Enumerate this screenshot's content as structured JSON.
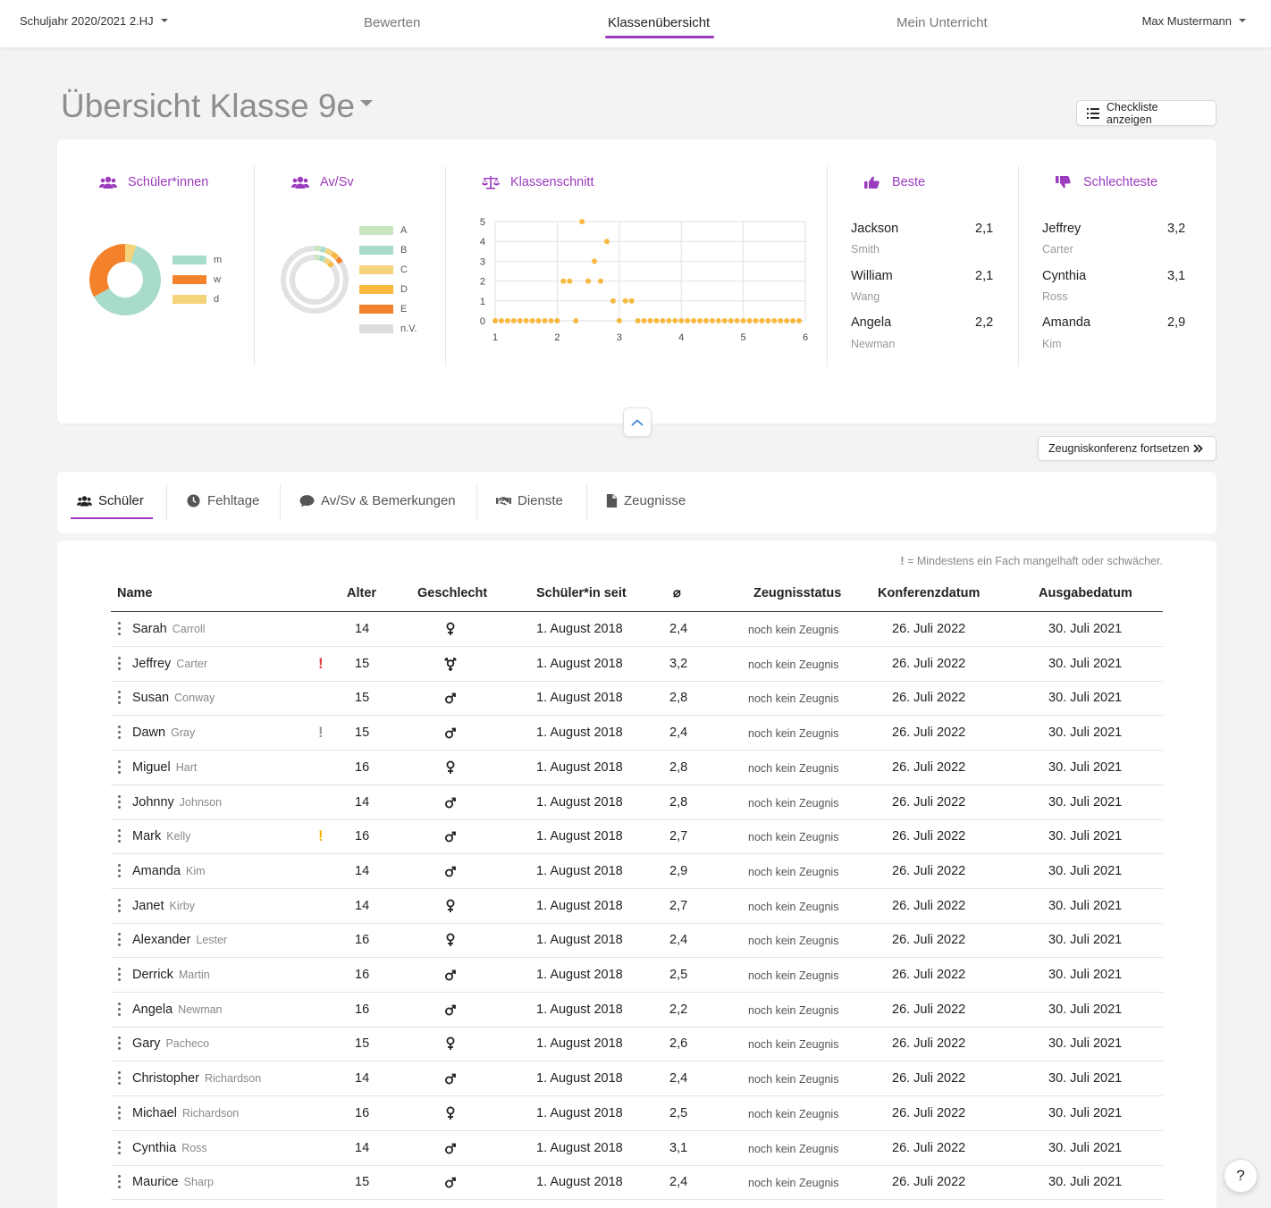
{
  "nav": {
    "year": "Schuljahr 2020/2021 2.HJ",
    "tabs": [
      "Bewerten",
      "Klassenübersicht",
      "Mein Unterricht"
    ],
    "active_tab": "Klassenübersicht",
    "user": "Max Mustermann",
    "accent": "#9b3bbd"
  },
  "page": {
    "title": "Übersicht Klasse 9e",
    "checklist_button": "Checkliste anzeigen",
    "continue_button": "Zeugniskonferenz fortsetzen"
  },
  "stats": {
    "students": {
      "title": "Schüler*innen",
      "legend": [
        "m",
        "w",
        "d"
      ],
      "colors": [
        "#a8dbc9",
        "#f4822c",
        "#f5d37a"
      ],
      "values": [
        0.62,
        0.33,
        0.05
      ]
    },
    "avsv": {
      "title": "Av/Sv",
      "legend": [
        "A",
        "B",
        "C",
        "D",
        "E",
        "n.V."
      ],
      "colors": [
        "#c9e6c0",
        "#a8dbc9",
        "#f5d37a",
        "#f7b93f",
        "#f4822c",
        "#dcdcdc"
      ]
    },
    "class_avg": {
      "title": "Klassenschnitt"
    },
    "best": {
      "title": "Beste",
      "items": [
        {
          "first": "Jackson",
          "last": "Smith",
          "value": "2,1"
        },
        {
          "first": "William",
          "last": "Wang",
          "value": "2,1"
        },
        {
          "first": "Angela",
          "last": "Newman",
          "value": "2,2"
        }
      ]
    },
    "worst": {
      "title": "Schlechteste",
      "items": [
        {
          "first": "Jeffrey",
          "last": "Carter",
          "value": "3,2"
        },
        {
          "first": "Cynthia",
          "last": "Ross",
          "value": "3,1"
        },
        {
          "first": "Amanda",
          "last": "Kim",
          "value": "2,9"
        }
      ]
    }
  },
  "chart_data": {
    "type": "scatter",
    "title": "",
    "xlabel": "",
    "ylabel": "",
    "xlim": [
      1,
      6
    ],
    "ylim": [
      0,
      5
    ],
    "x_ticks": [
      "1",
      "2",
      "3",
      "4",
      "5",
      "6"
    ],
    "y_ticks": [
      "0",
      "1",
      "2",
      "3",
      "4",
      "5"
    ],
    "grid": true,
    "color": "#f7b93f",
    "series": [
      {
        "points": [
          [
            2.1,
            2
          ],
          [
            2.2,
            2
          ],
          [
            2.4,
            5
          ],
          [
            2.5,
            2
          ],
          [
            2.6,
            3
          ],
          [
            2.7,
            2
          ],
          [
            2.8,
            4
          ],
          [
            2.9,
            1
          ],
          [
            3.1,
            1
          ],
          [
            3.2,
            1
          ],
          [
            1.0,
            0
          ],
          [
            1.1,
            0
          ],
          [
            1.2,
            0
          ],
          [
            1.3,
            0
          ],
          [
            1.4,
            0
          ],
          [
            1.5,
            0
          ],
          [
            1.6,
            0
          ],
          [
            1.7,
            0
          ],
          [
            1.8,
            0
          ],
          [
            1.9,
            0
          ],
          [
            2.0,
            0
          ],
          [
            2.3,
            0
          ],
          [
            3.0,
            0
          ],
          [
            3.3,
            0
          ],
          [
            3.4,
            0
          ],
          [
            3.5,
            0
          ],
          [
            3.6,
            0
          ],
          [
            3.7,
            0
          ],
          [
            3.8,
            0
          ],
          [
            3.9,
            0
          ],
          [
            4.0,
            0
          ],
          [
            4.1,
            0
          ],
          [
            4.2,
            0
          ],
          [
            4.3,
            0
          ],
          [
            4.4,
            0
          ],
          [
            4.5,
            0
          ],
          [
            4.6,
            0
          ],
          [
            4.7,
            0
          ],
          [
            4.8,
            0
          ],
          [
            4.9,
            0
          ],
          [
            5.0,
            0
          ],
          [
            5.1,
            0
          ],
          [
            5.2,
            0
          ],
          [
            5.3,
            0
          ],
          [
            5.4,
            0
          ],
          [
            5.5,
            0
          ],
          [
            5.6,
            0
          ],
          [
            5.7,
            0
          ],
          [
            5.8,
            0
          ],
          [
            5.9,
            0
          ]
        ]
      }
    ]
  },
  "tabs": [
    {
      "label": "Schüler",
      "icon": "users-icon"
    },
    {
      "label": "Fehltage",
      "icon": "clock-icon"
    },
    {
      "label": "Av/Sv & Bemerkungen",
      "icon": "comment-icon"
    },
    {
      "label": "Dienste",
      "icon": "handshake-icon"
    },
    {
      "label": "Zeugnisse",
      "icon": "file-icon"
    }
  ],
  "table": {
    "legend_symbol": "!",
    "legend_text": " = Mindestens ein Fach mangelhaft oder schwächer.",
    "headers": [
      "Name",
      "Alter",
      "Geschlecht",
      "Schüler*in seit",
      "⌀",
      "Zeugnisstatus",
      "Konferenzdatum",
      "Ausgabedatum"
    ],
    "rows": [
      {
        "first": "Sarah",
        "last": "Carroll",
        "warn": "",
        "age": "14",
        "gender": "f",
        "since": "1. August 2018",
        "avg": "2,4",
        "status": "noch kein Zeugnis",
        "conf": "26. Juli 2022",
        "issue": "30. Juli 2021"
      },
      {
        "first": "Jeffrey",
        "last": "Carter",
        "warn": "red",
        "age": "15",
        "gender": "d",
        "since": "1. August 2018",
        "avg": "3,2",
        "status": "noch kein Zeugnis",
        "conf": "26. Juli 2022",
        "issue": "30. Juli 2021"
      },
      {
        "first": "Susan",
        "last": "Conway",
        "warn": "",
        "age": "15",
        "gender": "m",
        "since": "1. August 2018",
        "avg": "2,8",
        "status": "noch kein Zeugnis",
        "conf": "26. Juli 2022",
        "issue": "30. Juli 2021"
      },
      {
        "first": "Dawn",
        "last": "Gray",
        "warn": "gray",
        "age": "15",
        "gender": "m",
        "since": "1. August 2018",
        "avg": "2,4",
        "status": "noch kein Zeugnis",
        "conf": "26. Juli 2022",
        "issue": "30. Juli 2021"
      },
      {
        "first": "Miguel",
        "last": "Hart",
        "warn": "",
        "age": "16",
        "gender": "f",
        "since": "1. August 2018",
        "avg": "2,8",
        "status": "noch kein Zeugnis",
        "conf": "26. Juli 2022",
        "issue": "30. Juli 2021"
      },
      {
        "first": "Johnny",
        "last": "Johnson",
        "warn": "",
        "age": "14",
        "gender": "m",
        "since": "1. August 2018",
        "avg": "2,8",
        "status": "noch kein Zeugnis",
        "conf": "26. Juli 2022",
        "issue": "30. Juli 2021"
      },
      {
        "first": "Mark",
        "last": "Kelly",
        "warn": "yellow",
        "age": "16",
        "gender": "m",
        "since": "1. August 2018",
        "avg": "2,7",
        "status": "noch kein Zeugnis",
        "conf": "26. Juli 2022",
        "issue": "30. Juli 2021"
      },
      {
        "first": "Amanda",
        "last": "Kim",
        "warn": "",
        "age": "14",
        "gender": "m",
        "since": "1. August 2018",
        "avg": "2,9",
        "status": "noch kein Zeugnis",
        "conf": "26. Juli 2022",
        "issue": "30. Juli 2021"
      },
      {
        "first": "Janet",
        "last": "Kirby",
        "warn": "",
        "age": "14",
        "gender": "f",
        "since": "1. August 2018",
        "avg": "2,7",
        "status": "noch kein Zeugnis",
        "conf": "26. Juli 2022",
        "issue": "30. Juli 2021"
      },
      {
        "first": "Alexander",
        "last": "Lester",
        "warn": "",
        "age": "16",
        "gender": "f",
        "since": "1. August 2018",
        "avg": "2,4",
        "status": "noch kein Zeugnis",
        "conf": "26. Juli 2022",
        "issue": "30. Juli 2021"
      },
      {
        "first": "Derrick",
        "last": "Martin",
        "warn": "",
        "age": "16",
        "gender": "m",
        "since": "1. August 2018",
        "avg": "2,5",
        "status": "noch kein Zeugnis",
        "conf": "26. Juli 2022",
        "issue": "30. Juli 2021"
      },
      {
        "first": "Angela",
        "last": "Newman",
        "warn": "",
        "age": "16",
        "gender": "m",
        "since": "1. August 2018",
        "avg": "2,2",
        "status": "noch kein Zeugnis",
        "conf": "26. Juli 2022",
        "issue": "30. Juli 2021"
      },
      {
        "first": "Gary",
        "last": "Pacheco",
        "warn": "",
        "age": "15",
        "gender": "f",
        "since": "1. August 2018",
        "avg": "2,6",
        "status": "noch kein Zeugnis",
        "conf": "26. Juli 2022",
        "issue": "30. Juli 2021"
      },
      {
        "first": "Christopher",
        "last": "Richardson",
        "warn": "",
        "age": "14",
        "gender": "m",
        "since": "1. August 2018",
        "avg": "2,4",
        "status": "noch kein Zeugnis",
        "conf": "26. Juli 2022",
        "issue": "30. Juli 2021"
      },
      {
        "first": "Michael",
        "last": "Richardson",
        "warn": "",
        "age": "16",
        "gender": "f",
        "since": "1. August 2018",
        "avg": "2,5",
        "status": "noch kein Zeugnis",
        "conf": "26. Juli 2022",
        "issue": "30. Juli 2021"
      },
      {
        "first": "Cynthia",
        "last": "Ross",
        "warn": "",
        "age": "14",
        "gender": "m",
        "since": "1. August 2018",
        "avg": "3,1",
        "status": "noch kein Zeugnis",
        "conf": "26. Juli 2022",
        "issue": "30. Juli 2021"
      },
      {
        "first": "Maurice",
        "last": "Sharp",
        "warn": "",
        "age": "15",
        "gender": "m",
        "since": "1. August 2018",
        "avg": "2,4",
        "status": "noch kein Zeugnis",
        "conf": "26. Juli 2022",
        "issue": "30. Juli 2021"
      }
    ]
  },
  "help": "?"
}
